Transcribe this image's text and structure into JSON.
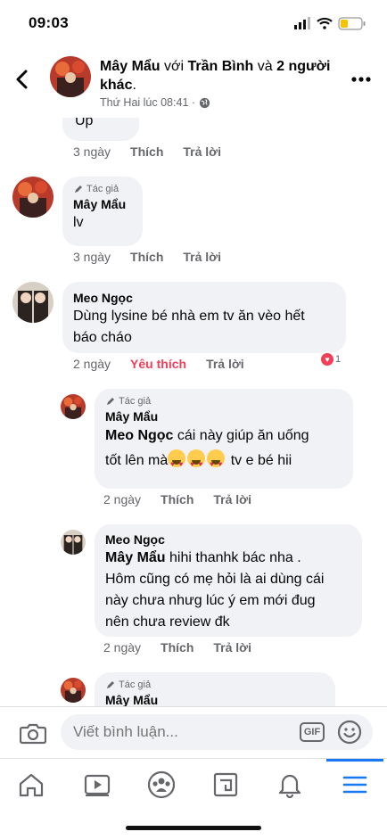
{
  "status_bar": {
    "time": "09:03"
  },
  "header": {
    "author": "Mây Mẩu",
    "with_text": " với ",
    "tagged": "Trần Bình",
    "and_text": " và ",
    "others": "2 người khác",
    "end": ".",
    "timestamp": "Thứ Hai lúc 08:41 ·"
  },
  "comments": [
    {
      "text": "Up",
      "time": "3 ngày",
      "like": "Thích",
      "reply": "Trả lời"
    },
    {
      "author_tag": "Tác giả",
      "name": "Mây Mẩu",
      "text": "lv",
      "time": "3 ngày",
      "like": "Thích",
      "reply": "Trả lời"
    },
    {
      "name": "Meo Ngọc",
      "line1": "Dùng lysine bé nhà em tv ăn vèo hết",
      "line2": "báo cháo",
      "time": "2 ngày",
      "like": "Yêu thích",
      "reply": "Trả lời",
      "reaction_count": "1"
    }
  ],
  "replies": [
    {
      "author_tag": "Tác giả",
      "name": "Mây Mẩu",
      "mention": "Meo Ngọc",
      "line1_rest": " cái này giúp ăn uống",
      "line2_pre": "tốt lên mà",
      "line2_post": " tv e bé hii",
      "time": "2 ngày",
      "like": "Thích",
      "reply": "Trả lời"
    },
    {
      "name": "Meo Ngọc",
      "mention": "Mây Mẩu",
      "line1_rest": " hihi thanhk bác nha .",
      "line2": "Hôm cũng có mẹ hỏi là ai dùng cái",
      "line3": "này chưa nhưg lúc ý em mới đug",
      "line4": "nên chưa review đk",
      "time": "2 ngày",
      "like": "Thích",
      "reply": "Trả lời"
    },
    {
      "author_tag": "Tác giả",
      "name": "Mây Mẩu"
    }
  ],
  "composer": {
    "placeholder": "Viết bình luận...",
    "gif": "GIF"
  },
  "icons": {
    "back": "chevron-left-icon",
    "more": "more-dots-icon",
    "camera": "camera-icon",
    "smiley": "smiley-icon",
    "tabs": [
      "home-icon",
      "video-icon",
      "groups-icon",
      "marketplace-icon",
      "bell-icon",
      "menu-icon"
    ]
  },
  "colors": {
    "accent": "#1877f2",
    "love": "#f33e58",
    "bubble": "#f0f2f5",
    "muted": "#65676b"
  }
}
